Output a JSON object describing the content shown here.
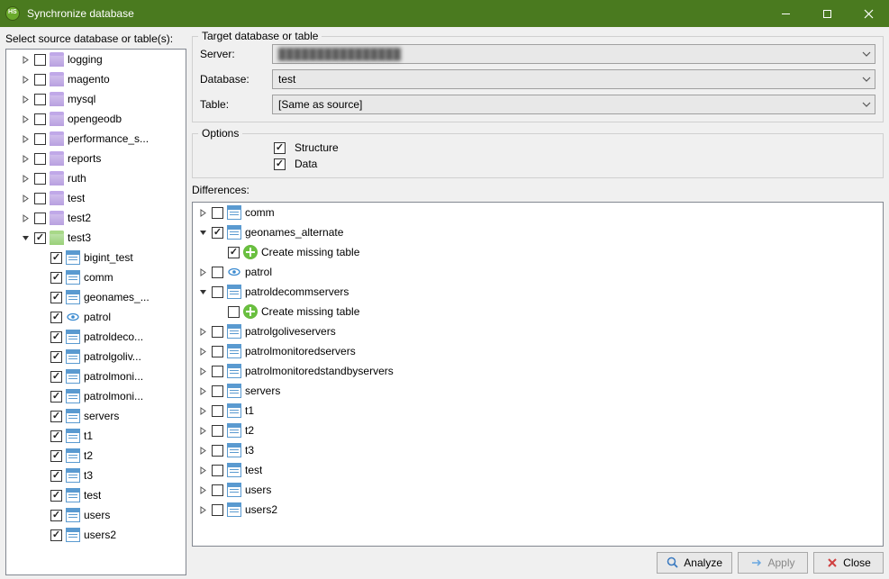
{
  "window": {
    "title": "Synchronize database"
  },
  "left": {
    "label": "Select source database or table(s):",
    "items": [
      {
        "indent": 1,
        "twisty": "right",
        "checked": false,
        "icon": "db",
        "label": "logging"
      },
      {
        "indent": 1,
        "twisty": "right",
        "checked": false,
        "icon": "db",
        "label": "magento"
      },
      {
        "indent": 1,
        "twisty": "right",
        "checked": false,
        "icon": "db",
        "label": "mysql"
      },
      {
        "indent": 1,
        "twisty": "right",
        "checked": false,
        "icon": "db",
        "label": "opengeodb"
      },
      {
        "indent": 1,
        "twisty": "right",
        "checked": false,
        "icon": "db",
        "label": "performance_s..."
      },
      {
        "indent": 1,
        "twisty": "right",
        "checked": false,
        "icon": "db",
        "label": "reports"
      },
      {
        "indent": 1,
        "twisty": "right",
        "checked": false,
        "icon": "db",
        "label": "ruth"
      },
      {
        "indent": 1,
        "twisty": "right",
        "checked": false,
        "icon": "db",
        "label": "test"
      },
      {
        "indent": 1,
        "twisty": "right",
        "checked": false,
        "icon": "db",
        "label": "test2"
      },
      {
        "indent": 1,
        "twisty": "down",
        "checked": true,
        "icon": "dbg",
        "label": "test3"
      },
      {
        "indent": 2,
        "twisty": "none",
        "checked": true,
        "icon": "tbl",
        "label": "bigint_test"
      },
      {
        "indent": 2,
        "twisty": "none",
        "checked": true,
        "icon": "tbl",
        "label": "comm"
      },
      {
        "indent": 2,
        "twisty": "none",
        "checked": true,
        "icon": "tbl",
        "label": "geonames_..."
      },
      {
        "indent": 2,
        "twisty": "none",
        "checked": true,
        "icon": "eye",
        "label": "patrol"
      },
      {
        "indent": 2,
        "twisty": "none",
        "checked": true,
        "icon": "tbl",
        "label": "patroldeco..."
      },
      {
        "indent": 2,
        "twisty": "none",
        "checked": true,
        "icon": "tbl",
        "label": "patrolgoliv..."
      },
      {
        "indent": 2,
        "twisty": "none",
        "checked": true,
        "icon": "tbl",
        "label": "patrolmoni..."
      },
      {
        "indent": 2,
        "twisty": "none",
        "checked": true,
        "icon": "tbl",
        "label": "patrolmoni..."
      },
      {
        "indent": 2,
        "twisty": "none",
        "checked": true,
        "icon": "tbl",
        "label": "servers"
      },
      {
        "indent": 2,
        "twisty": "none",
        "checked": true,
        "icon": "tbl",
        "label": "t1"
      },
      {
        "indent": 2,
        "twisty": "none",
        "checked": true,
        "icon": "tbl",
        "label": "t2"
      },
      {
        "indent": 2,
        "twisty": "none",
        "checked": true,
        "icon": "tbl",
        "label": "t3"
      },
      {
        "indent": 2,
        "twisty": "none",
        "checked": true,
        "icon": "tbl",
        "label": "test"
      },
      {
        "indent": 2,
        "twisty": "none",
        "checked": true,
        "icon": "tbl",
        "label": "users"
      },
      {
        "indent": 2,
        "twisty": "none",
        "checked": true,
        "icon": "tbl",
        "label": "users2"
      }
    ]
  },
  "target": {
    "legend": "Target database or table",
    "server_label": "Server:",
    "server_value": "████████████████",
    "database_label": "Database:",
    "database_value": "test",
    "table_label": "Table:",
    "table_value": "[Same as source]"
  },
  "options": {
    "legend": "Options",
    "structure_label": "Structure",
    "structure_checked": true,
    "data_label": "Data",
    "data_checked": true
  },
  "differences": {
    "label": "Differences:",
    "items": [
      {
        "indent": 1,
        "twisty": "right",
        "checked": false,
        "icon": "tbl",
        "label": "comm"
      },
      {
        "indent": 1,
        "twisty": "down",
        "checked": true,
        "icon": "tbl",
        "label": "geonames_alternate"
      },
      {
        "indent": 2,
        "twisty": "none",
        "checked": true,
        "icon": "plus",
        "label": "Create missing table"
      },
      {
        "indent": 1,
        "twisty": "right",
        "checked": false,
        "icon": "eye",
        "label": "patrol"
      },
      {
        "indent": 1,
        "twisty": "down",
        "checked": false,
        "icon": "tbl",
        "label": "patroldecommservers"
      },
      {
        "indent": 2,
        "twisty": "none",
        "checked": false,
        "icon": "plus",
        "label": "Create missing table"
      },
      {
        "indent": 1,
        "twisty": "right",
        "checked": false,
        "icon": "tbl",
        "label": "patrolgoliveservers"
      },
      {
        "indent": 1,
        "twisty": "right",
        "checked": false,
        "icon": "tbl",
        "label": "patrolmonitoredservers"
      },
      {
        "indent": 1,
        "twisty": "right",
        "checked": false,
        "icon": "tbl",
        "label": "patrolmonitoredstandbyservers"
      },
      {
        "indent": 1,
        "twisty": "right",
        "checked": false,
        "icon": "tbl",
        "label": "servers"
      },
      {
        "indent": 1,
        "twisty": "right",
        "checked": false,
        "icon": "tbl",
        "label": "t1"
      },
      {
        "indent": 1,
        "twisty": "right",
        "checked": false,
        "icon": "tbl",
        "label": "t2"
      },
      {
        "indent": 1,
        "twisty": "right",
        "checked": false,
        "icon": "tbl",
        "label": "t3"
      },
      {
        "indent": 1,
        "twisty": "right",
        "checked": false,
        "icon": "tbl",
        "label": "test"
      },
      {
        "indent": 1,
        "twisty": "right",
        "checked": false,
        "icon": "tbl",
        "label": "users"
      },
      {
        "indent": 1,
        "twisty": "right",
        "checked": false,
        "icon": "tbl",
        "label": "users2"
      }
    ]
  },
  "buttons": {
    "analyze": "Analyze",
    "apply": "Apply",
    "close": "Close"
  }
}
